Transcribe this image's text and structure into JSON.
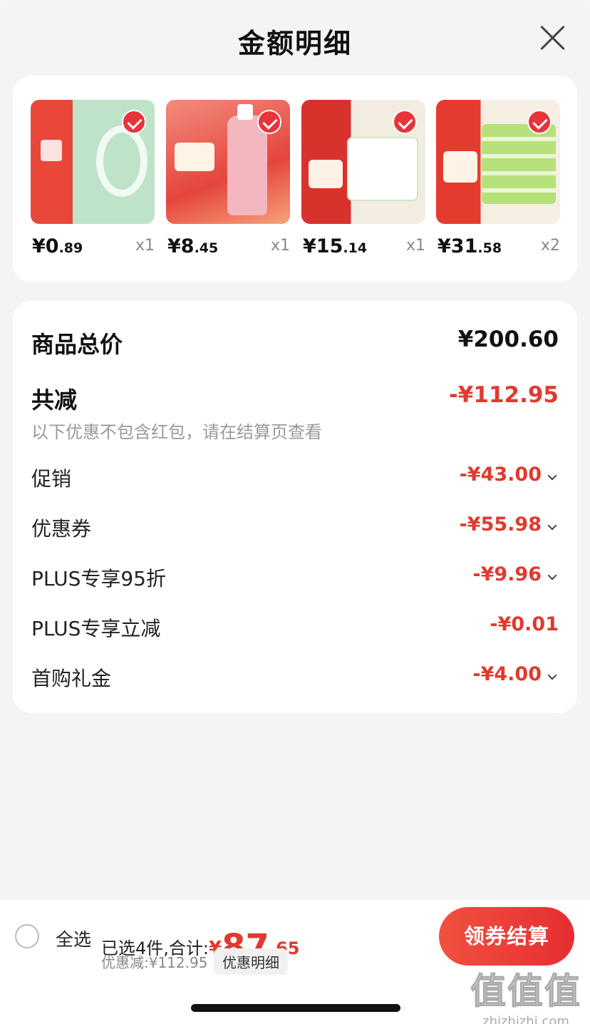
{
  "header": {
    "title": "金额明细"
  },
  "products": [
    {
      "price_int": "¥0",
      "price_cents": ".89",
      "qty": "x1"
    },
    {
      "price_int": "¥8",
      "price_cents": ".45",
      "qty": "x1"
    },
    {
      "price_int": "¥15",
      "price_cents": ".14",
      "qty": "x1"
    },
    {
      "price_int": "¥31",
      "price_cents": ".58",
      "qty": "x2"
    }
  ],
  "summary": {
    "total_label": "商品总价",
    "total_value": "¥200.60",
    "reduce_label": "共减",
    "reduce_value": "-¥112.95",
    "note": "以下优惠不包含红包，请在结算页查看",
    "items": [
      {
        "label": "促销",
        "value": "-¥43.00"
      },
      {
        "label": "优惠券",
        "value": "-¥55.98"
      },
      {
        "label": "PLUS专享95折",
        "value": "-¥9.96"
      },
      {
        "label": "PLUS专享立减",
        "value": "-¥0.01"
      },
      {
        "label": "首购礼金",
        "value": "-¥4.00"
      }
    ]
  },
  "footer": {
    "select_all": "全选",
    "picked_text": "已选4件,合计:",
    "currency": "¥",
    "amount_int": "87",
    "amount_cents": ".65",
    "discount_text": "优惠减:¥112.95",
    "detail_button": "优惠明细",
    "checkout_button": "领券结算",
    "watermark": "值值值",
    "watermark_url": "zhizhizhi.com"
  },
  "colors": {
    "accent": "#e03a2f",
    "button": "#e62e33"
  }
}
